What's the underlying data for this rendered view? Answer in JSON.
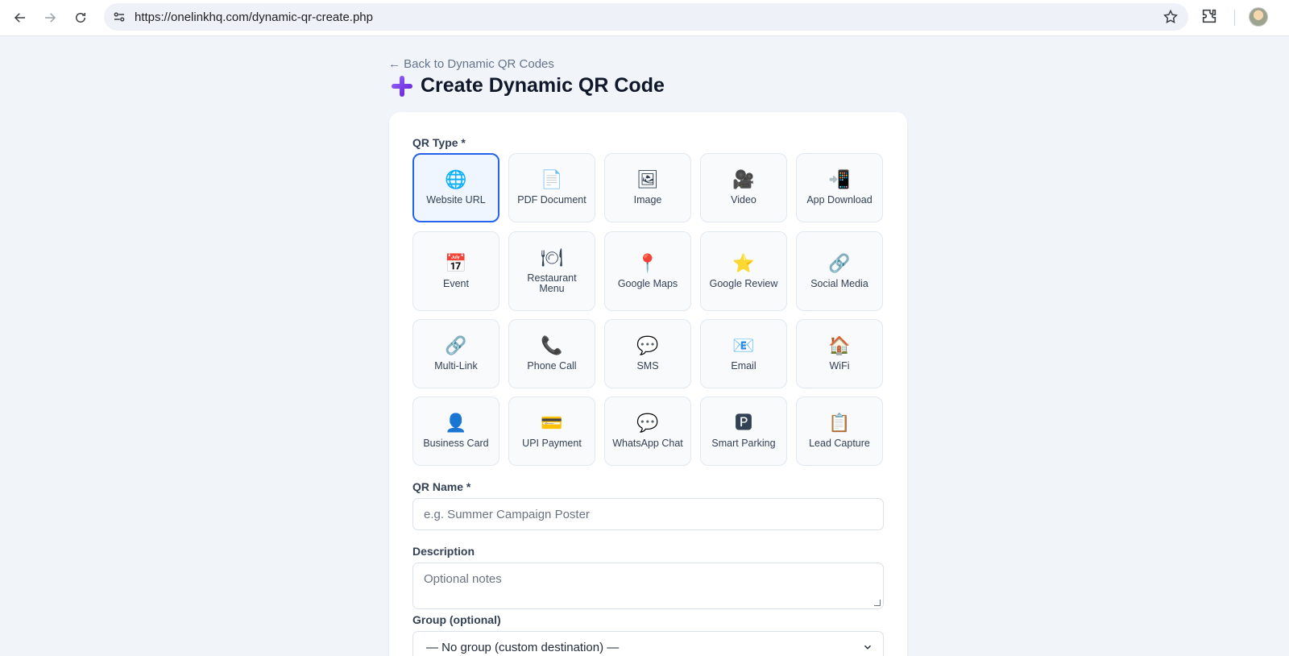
{
  "browser": {
    "url": "https://onelinkhq.com/dynamic-qr-create.php"
  },
  "page": {
    "back_link": "← Back to Dynamic QR Codes",
    "title": "Create Dynamic QR Code"
  },
  "form": {
    "qr_type_label": "QR Type *",
    "types": [
      {
        "label": "Website URL",
        "icon": "🌐",
        "icon_name": "globe-icon",
        "selected": true
      },
      {
        "label": "PDF Document",
        "icon": "📄",
        "icon_name": "document-icon"
      },
      {
        "label": "Image",
        "icon": "🖼",
        "icon_name": "picture-icon"
      },
      {
        "label": "Video",
        "icon": "🎥",
        "icon_name": "movie-camera-icon"
      },
      {
        "label": "App Download",
        "icon": "📲",
        "icon_name": "mobile-arrow-icon"
      },
      {
        "label": "Event",
        "icon": "📅",
        "icon_name": "calendar-icon"
      },
      {
        "label": "Restaurant Menu",
        "icon": "🍽",
        "icon_name": "plate-cutlery-icon"
      },
      {
        "label": "Google Maps",
        "icon": "📍",
        "icon_name": "map-pin-icon"
      },
      {
        "label": "Google Review",
        "icon": "⭐",
        "icon_name": "star-icon"
      },
      {
        "label": "Social Media",
        "icon": "🔗",
        "icon_name": "link-icon"
      },
      {
        "label": "Multi-Link",
        "icon": "🔗",
        "icon_name": "link-icon"
      },
      {
        "label": "Phone Call",
        "icon": "📞",
        "icon_name": "phone-icon"
      },
      {
        "label": "SMS",
        "icon": "💬",
        "icon_name": "speech-bubble-icon"
      },
      {
        "label": "Email",
        "icon": "📧",
        "icon_name": "email-icon"
      },
      {
        "label": "WiFi",
        "icon": "🏠",
        "icon_name": "house-icon"
      },
      {
        "label": "Business Card",
        "icon": "👤",
        "icon_name": "person-icon"
      },
      {
        "label": "UPI Payment",
        "icon": "💳",
        "icon_name": "credit-card-icon"
      },
      {
        "label": "WhatsApp Chat",
        "icon": "💬",
        "icon_name": "speech-bubble-icon"
      },
      {
        "label": "Smart Parking",
        "icon": "🅿",
        "icon_name": "parking-icon"
      },
      {
        "label": "Lead Capture",
        "icon": "📋",
        "icon_name": "clipboard-icon"
      }
    ],
    "name_label": "QR Name *",
    "name_placeholder": "e.g. Summer Campaign Poster",
    "description_label": "Description",
    "description_placeholder": "Optional notes",
    "group_label": "Group (optional)",
    "group_selected": "— No group (custom destination) —"
  },
  "colors": {
    "selected_border": "#2563eb",
    "accent_purple": "#7c3aed"
  }
}
